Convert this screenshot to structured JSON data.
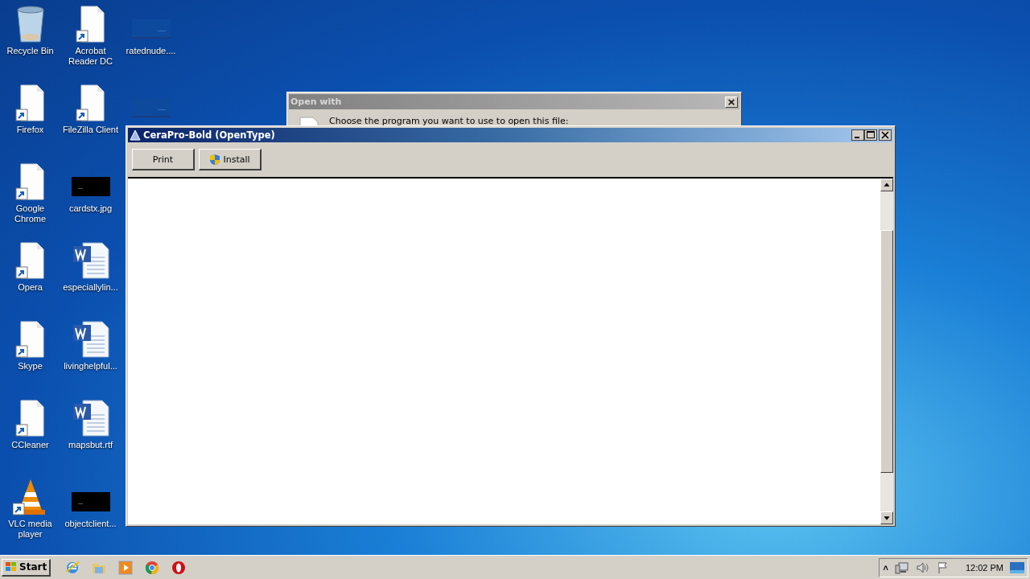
{
  "desktop_icons": [
    {
      "label": "Recycle Bin",
      "kind": "recycle"
    },
    {
      "label": "Firefox",
      "kind": "shortcut"
    },
    {
      "label": "Google Chrome",
      "kind": "shortcut"
    },
    {
      "label": "Opera",
      "kind": "shortcut"
    },
    {
      "label": "Skype",
      "kind": "shortcut"
    },
    {
      "label": "CCleaner",
      "kind": "shortcut"
    },
    {
      "label": "VLC media player",
      "kind": "vlc"
    },
    {
      "label": "Acrobat Reader DC",
      "kind": "shortcut"
    },
    {
      "label": "FileZilla Client",
      "kind": "shortcut"
    },
    {
      "label": "cardstx.jpg",
      "kind": "image"
    },
    {
      "label": "especiallylin...",
      "kind": "word"
    },
    {
      "label": "livinghelpful...",
      "kind": "word"
    },
    {
      "label": "mapsbut.rtf",
      "kind": "word"
    },
    {
      "label": "objectclient...",
      "kind": "image"
    },
    {
      "label": "ratednude....",
      "kind": "thumb"
    },
    {
      "kind": "thumb"
    }
  ],
  "open_with": {
    "title": "Open with",
    "message": "Choose the program you want to use to open this file:",
    "close": "×"
  },
  "font_window": {
    "title": "CeraPro-Bold (OpenType)",
    "buttons": [
      {
        "label": "Print",
        "kind": "plain"
      },
      {
        "label": "Install",
        "kind": "shield"
      }
    ]
  },
  "taskbar": {
    "start": "Start",
    "apps": [
      {
        "kind": "ie"
      },
      {
        "kind": "folder"
      },
      {
        "kind": "media"
      },
      {
        "kind": "chrome"
      },
      {
        "kind": "opera"
      }
    ],
    "clock": "12:02 PM",
    "tray_expand": "˄"
  }
}
